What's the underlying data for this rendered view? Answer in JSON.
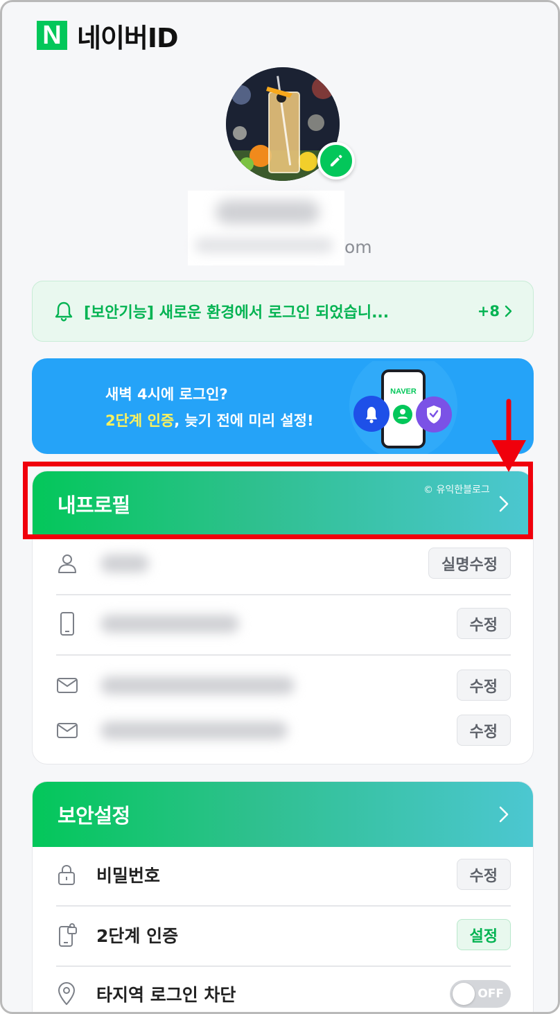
{
  "brand": {
    "logo_letter": "N",
    "title": "네이버ID",
    "color": "#03c75a"
  },
  "profile": {
    "email_suffix": "om"
  },
  "notice": {
    "text": "[보안기능] 새로운 환경에서 로그인 되었습니...",
    "count": "+8"
  },
  "banner": {
    "line1": "새벽 4시에 로그인?",
    "line2_highlight": "2단계 인증",
    "line2_rest": ", 늦기 전에 미리 설정!",
    "phone_label": "NAVER"
  },
  "my_profile": {
    "title": "내프로필",
    "watermark": "© 유익한블로그",
    "rows": [
      {
        "icon": "person-icon",
        "button": "실명수정"
      },
      {
        "icon": "phone-icon",
        "button": "수정"
      },
      {
        "icon": "mail-icon",
        "button": "수정"
      },
      {
        "icon": "mail-icon",
        "button": "수정"
      }
    ]
  },
  "security": {
    "title": "보안설정",
    "rows": [
      {
        "icon": "lock-icon",
        "label": "비밀번호",
        "button": "수정"
      },
      {
        "icon": "phone-lock-icon",
        "label": "2단계 인증",
        "button": "설정"
      },
      {
        "icon": "location-pin-icon",
        "label": "타지역 로그인 차단",
        "toggle": "OFF"
      }
    ]
  }
}
